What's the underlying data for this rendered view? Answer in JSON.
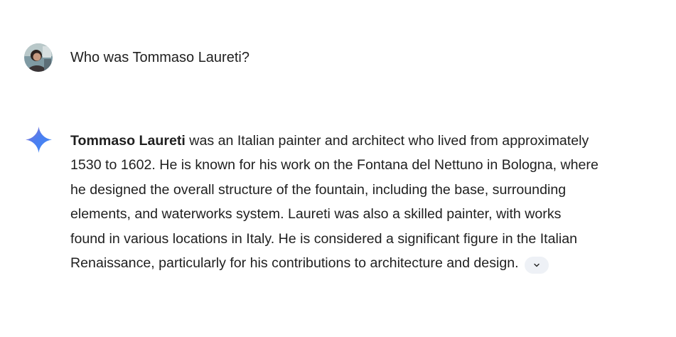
{
  "user_turn": {
    "avatar_icon": "user-avatar-photo",
    "prompt_text": "Who was Tommaso Laureti?"
  },
  "model_turn": {
    "spark_icon": "gemini-sparkle-icon",
    "lead_bold": "Tommaso Laureti",
    "lines": [
      " was an Italian painter and architect who lived from approximately",
      "1530 to 1602. He is known for his work on the Fontana del Nettuno in Bologna, where",
      "he designed the overall structure of the fountain, including the base, surrounding",
      "elements, and waterworks system. Laureti was also a skilled painter, with works",
      "found in various locations in Italy. He is considered a significant figure in the Italian",
      "Renaissance, particularly for his contributions to architecture and design."
    ],
    "expand_icon": "chevron-down-icon"
  },
  "colors": {
    "text": "#1f1f1f",
    "chip_bg": "#eef1f6",
    "spark_blue": "#4c7ef0",
    "spark_purple": "#9b72cb"
  }
}
